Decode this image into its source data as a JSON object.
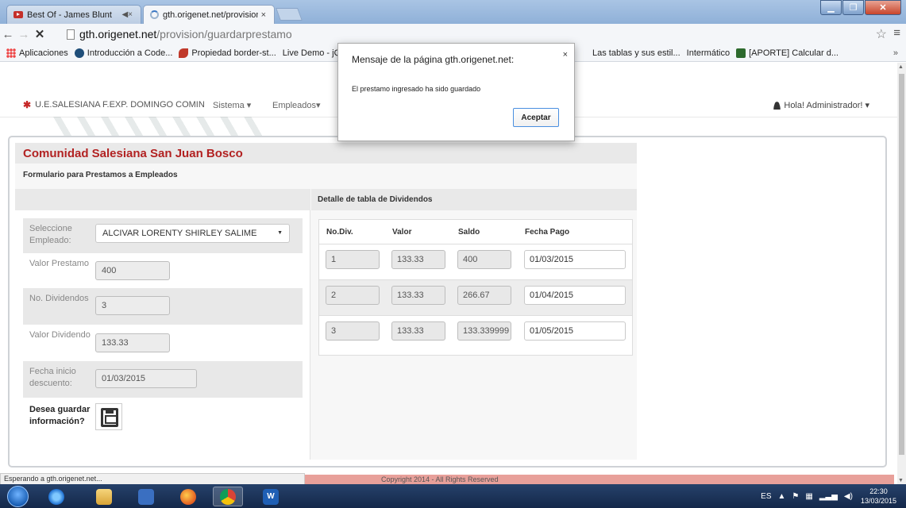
{
  "browser": {
    "tabs": [
      {
        "label": "Best Of - James Blunt",
        "audio": "◀×",
        "close": "×"
      },
      {
        "label": "gth.origenet.net/provision",
        "close": "×"
      }
    ],
    "url_host": "gth.origenet.net",
    "url_path": "/provision/guardarprestamo",
    "bookmarks": [
      {
        "label": "Aplicaciones",
        "icon": "apps-icon"
      },
      {
        "label": "Introducción a Code...",
        "icon": "codecademy-icon"
      },
      {
        "label": "Propiedad border-st...",
        "icon": "leaf-icon"
      },
      {
        "label": "Live Demo - jQ",
        "icon": "page-icon"
      }
    ],
    "bookmarks_right": [
      {
        "label": "Las tablas y sus estil...",
        "icon": "page-icon"
      },
      {
        "label": "Intermático",
        "icon": "page-icon"
      },
      {
        "label": "[APORTE] Calcular d...",
        "icon": "calc-icon"
      }
    ],
    "bookmarks_more": "»",
    "status": "Esperando a gth.origenet.net..."
  },
  "navbar": {
    "brand": "U.E.SALESIANA F.EXP. DOMINGO COMIN",
    "sistema": "Sistema ▾",
    "empleados": "Empleados▾",
    "user": "Hola! Administrador! ▾"
  },
  "card": {
    "title": "Comunidad Salesiana San Juan Bosco",
    "subtitle": "Formulario para Prestamos a Empleados",
    "dividends_header": "Detalle de tabla de Dividendos"
  },
  "form": {
    "employee_label": "Seleccione Empleado:",
    "employee_value": "ALCIVAR LORENTY SHIRLEY SALIME",
    "amount_label": "Valor Prestamo",
    "amount_value": "400",
    "dividends_label": "No. Dividendos",
    "dividends_value": "3",
    "dividend_value_label": "Valor Dividendo",
    "dividend_value_value": "133.33",
    "start_label": "Fecha inicio descuento:",
    "start_value": "01/03/2015",
    "save_label": "Desea guardar información?"
  },
  "dividends_table": {
    "columns": [
      "No.Div.",
      "Valor",
      "Saldo",
      "Fecha Pago"
    ],
    "rows": [
      {
        "no": "1",
        "valor": "133.33",
        "saldo": "400",
        "fecha": "01/03/2015"
      },
      {
        "no": "2",
        "valor": "133.33",
        "saldo": "266.67",
        "fecha": "01/04/2015"
      },
      {
        "no": "3",
        "valor": "133.33",
        "saldo": "133.339999",
        "fecha": "01/05/2015"
      }
    ]
  },
  "dialog": {
    "title": "Mensaje de la página gth.origenet.net:",
    "message": "El prestamo ingresado ha sido guardado",
    "ok": "Aceptar",
    "close": "×"
  },
  "footer": {
    "text": "Copyright 2014 - All Rights Reserved"
  },
  "taskbar": {
    "lang": "ES",
    "time": "22:30",
    "date": "13/03/2015"
  }
}
